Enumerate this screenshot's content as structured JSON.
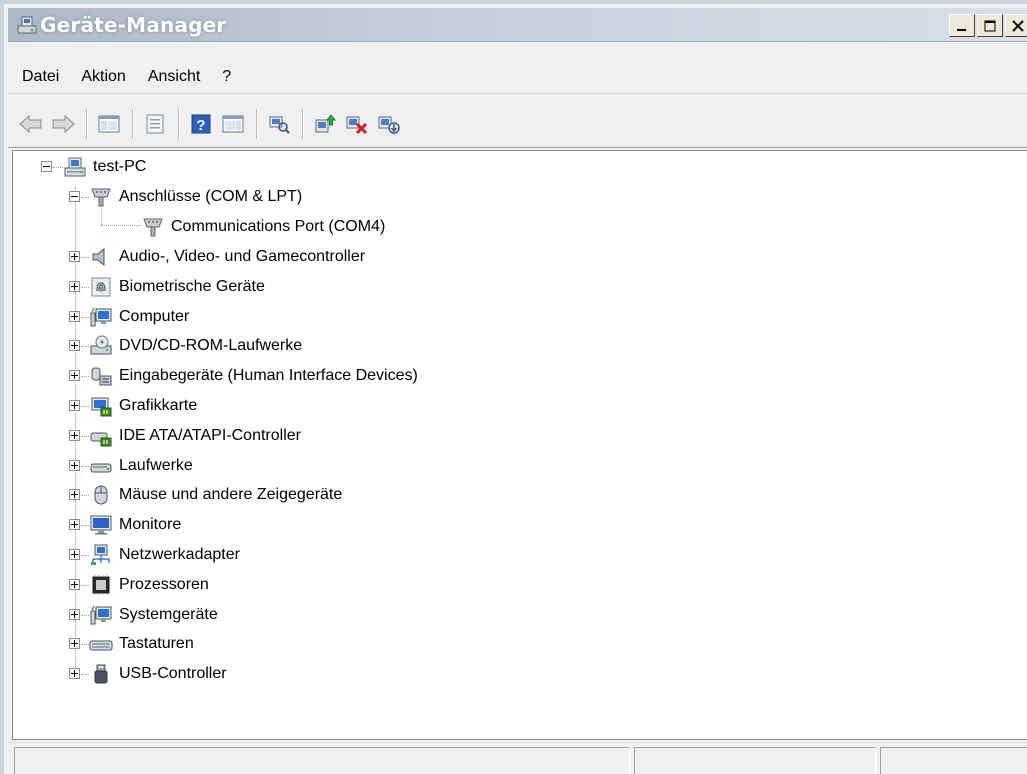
{
  "window": {
    "title": "Geräte-Manager",
    "buttons": [
      "minimize",
      "maximize",
      "close"
    ]
  },
  "menu": [
    "Datei",
    "Aktion",
    "Ansicht",
    "?"
  ],
  "toolbar": {
    "buttons": [
      {
        "icon": "back-arrow-icon"
      },
      {
        "icon": "forward-arrow-icon"
      },
      {
        "icon": "console-tree-icon"
      },
      {
        "icon": "properties-icon"
      },
      {
        "icon": "help-icon"
      },
      {
        "icon": "action-pane-icon"
      },
      {
        "icon": "scan-hardware-icon"
      },
      {
        "icon": "update-driver-icon"
      },
      {
        "icon": "uninstall-device-icon"
      },
      {
        "icon": "disable-device-icon"
      }
    ]
  },
  "tree": {
    "root": "test-PC",
    "items": [
      {
        "label": "Anschlüsse (COM & LPT)",
        "expanded": true,
        "icon": "port-icon",
        "children": [
          {
            "label": "Communications Port (COM4)",
            "icon": "port-icon"
          }
        ]
      },
      {
        "label": "Audio-, Video- und Gamecontroller",
        "icon": "speaker-icon"
      },
      {
        "label": "Biometrische Geräte",
        "icon": "fingerprint-icon"
      },
      {
        "label": "Computer",
        "icon": "computer-icon"
      },
      {
        "label": "DVD/CD-ROM-Laufwerke",
        "icon": "dvd-drive-icon"
      },
      {
        "label": "Eingabegeräte (Human Interface Devices)",
        "icon": "hid-icon"
      },
      {
        "label": "Grafikkarte",
        "icon": "display-adapter-icon"
      },
      {
        "label": "IDE ATA/ATAPI-Controller",
        "icon": "ide-controller-icon"
      },
      {
        "label": "Laufwerke",
        "icon": "disk-drive-icon"
      },
      {
        "label": "Mäuse und andere Zeigegeräte",
        "icon": "mouse-icon"
      },
      {
        "label": "Monitore",
        "icon": "monitor-icon"
      },
      {
        "label": "Netzwerkadapter",
        "icon": "network-adapter-icon"
      },
      {
        "label": "Prozessoren",
        "icon": "processor-icon"
      },
      {
        "label": "Systemgeräte",
        "icon": "system-device-icon"
      },
      {
        "label": "Tastaturen",
        "icon": "keyboard-icon"
      },
      {
        "label": "USB-Controller",
        "icon": "usb-icon"
      }
    ]
  },
  "colors": {
    "titlebar": "#b8c4d0",
    "window_bg": "#f0f0f0",
    "tree_bg": "#ffffff"
  }
}
